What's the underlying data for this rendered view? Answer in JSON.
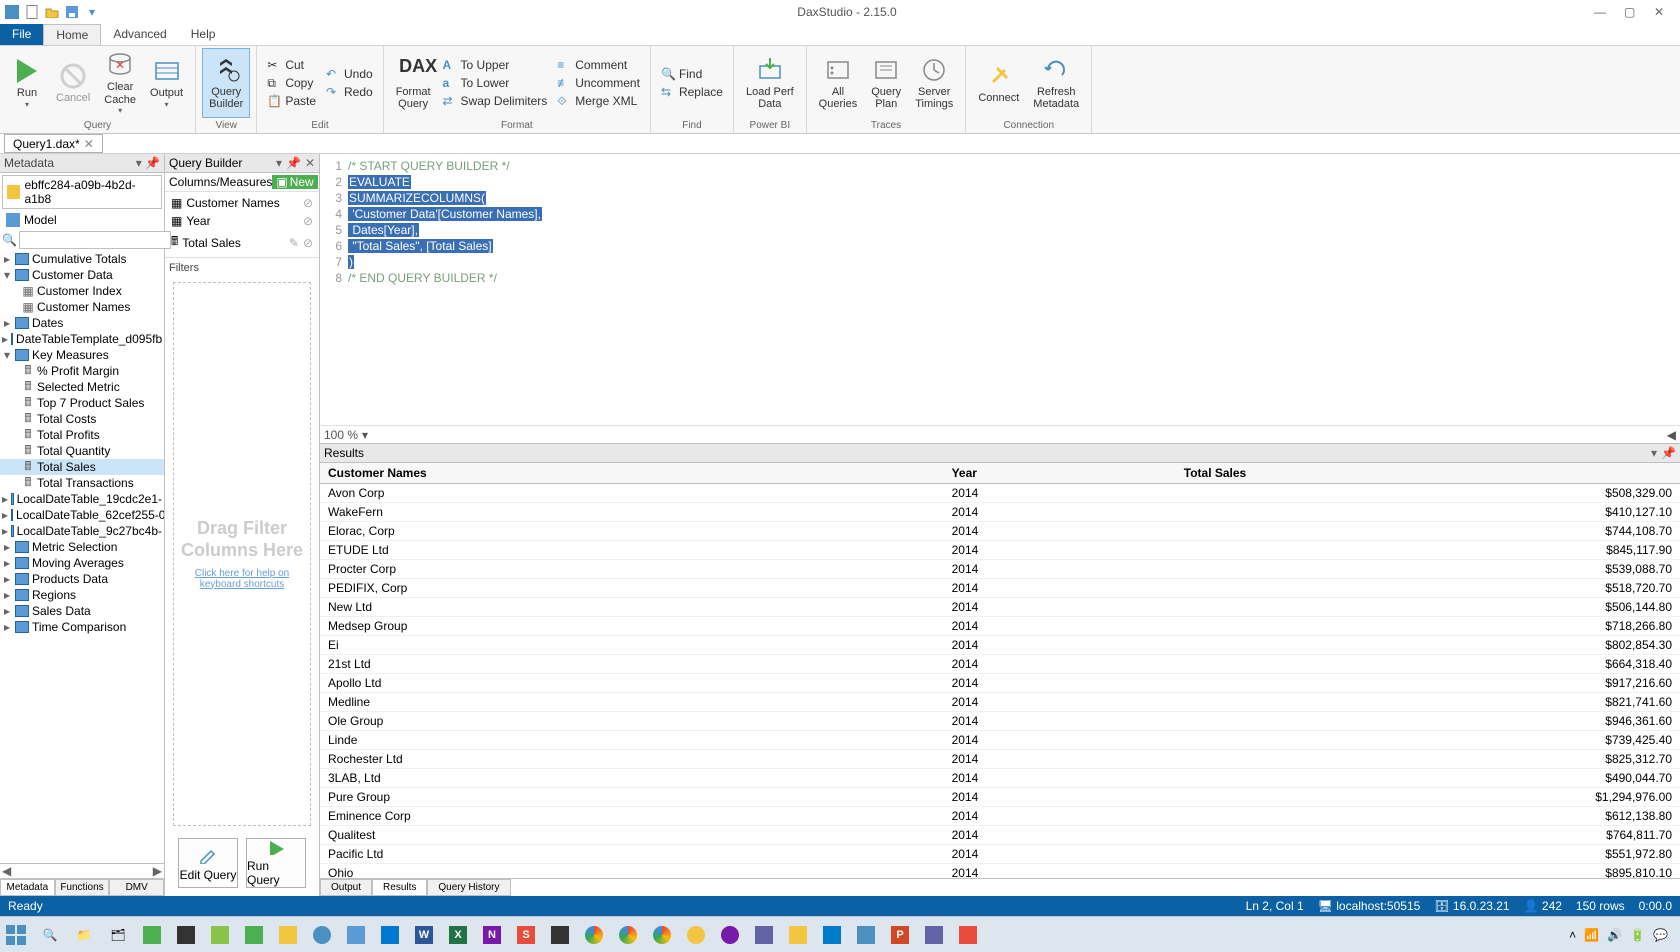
{
  "app": {
    "title": "DaxStudio - 2.15.0"
  },
  "menu": {
    "file": "File",
    "home": "Home",
    "advanced": "Advanced",
    "help": "Help"
  },
  "ribbon": {
    "run": "Run",
    "cancel": "Cancel",
    "clear_cache": "Clear\nCache",
    "output": "Output",
    "query_builder": "Query\nBuilder",
    "cut": "Cut",
    "copy": "Copy",
    "paste": "Paste",
    "undo": "Undo",
    "redo": "Redo",
    "format_query": "Format\nQuery",
    "to_upper": "To Upper",
    "to_lower": "To Lower",
    "swap_delim": "Swap Delimiters",
    "comment": "Comment",
    "uncomment": "Uncomment",
    "merge_xml": "Merge XML",
    "find": "Find",
    "replace": "Replace",
    "load_perf": "Load Perf\nData",
    "all_queries": "All\nQueries",
    "query_plan": "Query\nPlan",
    "server_timings": "Server\nTimings",
    "connect": "Connect",
    "refresh_meta": "Refresh\nMetadata",
    "groups": {
      "query": "Query",
      "view": "View",
      "edit": "Edit",
      "format": "Format",
      "find_g": "Find",
      "powerbi": "Power BI",
      "traces": "Traces",
      "connection": "Connection"
    }
  },
  "doctabs": {
    "tab1": "Query1.dax*"
  },
  "metadata": {
    "title": "Metadata",
    "db": "ebffc284-a09b-4b2d-a1b8",
    "model": "Model",
    "tables": [
      {
        "name": "Cumulative Totals",
        "open": false,
        "children": []
      },
      {
        "name": "Customer Data",
        "open": true,
        "children": [
          "Customer Index",
          "Customer Names"
        ]
      },
      {
        "name": "Dates",
        "open": false,
        "children": []
      },
      {
        "name": "DateTableTemplate_d095fb",
        "open": false,
        "children": []
      },
      {
        "name": "Key Measures",
        "open": true,
        "children": [
          "% Profit Margin",
          "Selected Metric",
          "Top 7 Product Sales",
          "Total Costs",
          "Total Profits",
          "Total Quantity",
          "Total Sales",
          "Total Transactions"
        ],
        "measures": true,
        "selected": "Total Sales"
      },
      {
        "name": "LocalDateTable_19cdc2e1-",
        "open": false,
        "children": []
      },
      {
        "name": "LocalDateTable_62cef255-0",
        "open": false,
        "children": []
      },
      {
        "name": "LocalDateTable_9c27bc4b-",
        "open": false,
        "children": []
      },
      {
        "name": "Metric Selection",
        "open": false,
        "children": []
      },
      {
        "name": "Moving Averages",
        "open": false,
        "children": []
      },
      {
        "name": "Products Data",
        "open": false,
        "children": []
      },
      {
        "name": "Regions",
        "open": false,
        "children": []
      },
      {
        "name": "Sales Data",
        "open": false,
        "children": []
      },
      {
        "name": "Time Comparison",
        "open": false,
        "children": []
      }
    ],
    "bottom_tabs": {
      "metadata": "Metadata",
      "functions": "Functions",
      "dmv": "DMV"
    }
  },
  "qb": {
    "title": "Query Builder",
    "cm_title": "Columns/Measures",
    "new": "New",
    "items": [
      {
        "name": "Customer Names",
        "type": "col"
      },
      {
        "name": "Year",
        "type": "col"
      },
      {
        "name": "Total Sales",
        "type": "measure"
      }
    ],
    "filters": "Filters",
    "drop_text": "Drag Filter Columns Here",
    "help_link": "Click here for help on keyboard shortcuts",
    "edit_query": "Edit Query",
    "run_query": "Run Query"
  },
  "code": {
    "lines": [
      {
        "n": 1,
        "t": "/* START QUERY BUILDER */",
        "cls": "cmt"
      },
      {
        "n": 2,
        "t": "EVALUATE",
        "cls": "sel"
      },
      {
        "n": 3,
        "t": "SUMMARIZECOLUMNS(",
        "cls": "sel"
      },
      {
        "n": 4,
        "t": "    'Customer Data'[Customer Names],",
        "cls": "sel"
      },
      {
        "n": 5,
        "t": "    Dates[Year],",
        "cls": "sel"
      },
      {
        "n": 6,
        "t": "    \"Total Sales\", [Total Sales]",
        "cls": "sel"
      },
      {
        "n": 7,
        "t": ")",
        "cls": "sel"
      },
      {
        "n": 8,
        "t": "/* END QUERY BUILDER */",
        "cls": "cmt"
      }
    ],
    "zoom": "100 %"
  },
  "results": {
    "title": "Results",
    "columns": [
      "Customer Names",
      "Year",
      "Total Sales"
    ],
    "rows": [
      [
        "Avon Corp",
        "2014",
        "$508,329.00"
      ],
      [
        "WakeFern",
        "2014",
        "$410,127.10"
      ],
      [
        "Elorac, Corp",
        "2014",
        "$744,108.70"
      ],
      [
        "ETUDE Ltd",
        "2014",
        "$845,117.90"
      ],
      [
        "Procter Corp",
        "2014",
        "$539,088.70"
      ],
      [
        "PEDIFIX, Corp",
        "2014",
        "$518,720.70"
      ],
      [
        "New Ltd",
        "2014",
        "$506,144.80"
      ],
      [
        "Medsep Group",
        "2014",
        "$718,266.80"
      ],
      [
        "Ei",
        "2014",
        "$802,854.30"
      ],
      [
        "21st Ltd",
        "2014",
        "$664,318.40"
      ],
      [
        "Apollo Ltd",
        "2014",
        "$917,216.60"
      ],
      [
        "Medline",
        "2014",
        "$821,741.60"
      ],
      [
        "Ole Group",
        "2014",
        "$946,361.60"
      ],
      [
        "Linde",
        "2014",
        "$739,425.40"
      ],
      [
        "Rochester Ltd",
        "2014",
        "$825,312.70"
      ],
      [
        "3LAB, Ltd",
        "2014",
        "$490,044.70"
      ],
      [
        "Pure Group",
        "2014",
        "$1,294,976.00"
      ],
      [
        "Eminence Corp",
        "2014",
        "$612,138.80"
      ],
      [
        "Qualitest",
        "2014",
        "$764,811.70"
      ],
      [
        "Pacific Ltd",
        "2014",
        "$551,972.80"
      ],
      [
        "Ohio",
        "2014",
        "$895,810.10"
      ]
    ],
    "tabs": {
      "output": "Output",
      "results": "Results",
      "history": "Query History"
    }
  },
  "status": {
    "ready": "Ready",
    "pos": "Ln 2, Col 1",
    "server": "localhost:50515",
    "version": "16.0.23.21",
    "rows_n": "242",
    "rowcount": "150 rows",
    "time": "0:00.0"
  }
}
